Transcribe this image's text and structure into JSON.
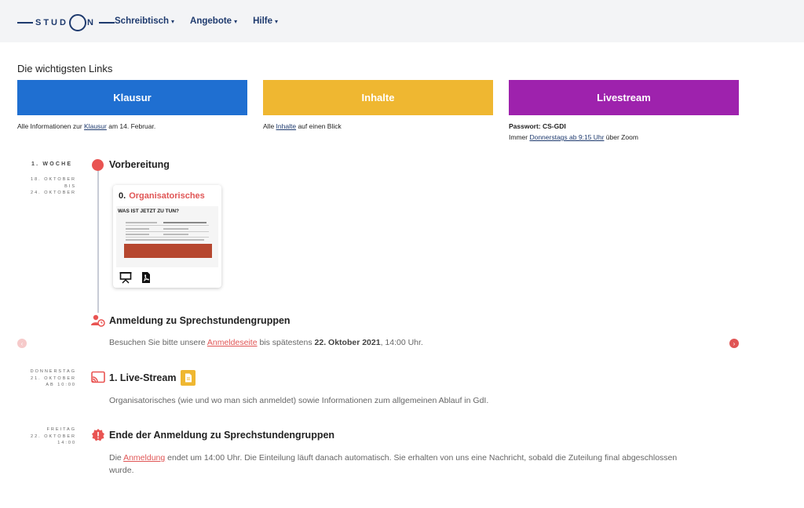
{
  "header": {
    "logo_left": "STUD",
    "logo_right": "N",
    "nav": [
      {
        "label": "Schreibtisch"
      },
      {
        "label": "Angebote"
      },
      {
        "label": "Hilfe"
      }
    ]
  },
  "links": {
    "title": "Die wichtigsten Links",
    "klausur": {
      "label": "Klausur",
      "desc_pre": "Alle Informationen zur ",
      "desc_link": "Klausur",
      "desc_post": " am 14. Februar."
    },
    "inhalte": {
      "label": "Inhalte",
      "desc_pre": "Alle ",
      "desc_link": "Inhalte",
      "desc_post": " auf einen Blick"
    },
    "livestream": {
      "label": "Livestream",
      "password": "Passwort: CS-GDI",
      "desc_pre": "Immer ",
      "desc_link": "Donnerstags ab 9:15 Uhr",
      "desc_post": " über Zoom"
    }
  },
  "timeline": {
    "week_label": "1. WOCHE",
    "week_dates": [
      "18. OKTOBER",
      "BIS",
      "24. OKTOBER"
    ],
    "section_title": "Vorbereitung",
    "card": {
      "num": "0.",
      "title": "Organisatorisches",
      "thumb_heading": "WAS IST JETZT ZU TUN?"
    },
    "entries": [
      {
        "title": "Anmeldung zu Sprechstundengruppen",
        "text_pre": "Besuchen Sie bitte unsere ",
        "text_link": "Anmeldeseite",
        "text_mid": " bis spätestens ",
        "text_bold": "22. Oktober 2021",
        "text_post": ", 14:00 Uhr."
      },
      {
        "date_lines": [
          "DONNERSTAG",
          "21. OKTOBER",
          "AB 10:00"
        ],
        "title": "1. Live-Stream",
        "text": "Organisatorisches (wie und wo man sich anmeldet) sowie Informationen zum allgemeinen Ablauf in GdI."
      },
      {
        "date_lines": [
          "FREITAG",
          "22. OKTOBER",
          "14:00"
        ],
        "title": "Ende der Anmeldung zu Sprechstundengruppen",
        "text_pre": "Die ",
        "text_link": "Anmeldung",
        "text_post": " endet um 14:00 Uhr. Die Einteilung läuft danach automatisch. Sie erhalten von uns eine Nachricht, sobald die Zuteilung final abgeschlossen",
        "text_line2": "wurde."
      }
    ]
  },
  "colors": {
    "blue": "#1f6fd1",
    "yellow": "#efb731",
    "purple": "#9e22ad",
    "red": "#e95452",
    "navy": "#1e3a6e"
  },
  "icons": [
    "presentation-icon",
    "pdf-icon",
    "person-clock-icon",
    "cast-icon",
    "document-icon",
    "alert-badge-icon",
    "chevron-left-icon",
    "chevron-right-icon"
  ]
}
